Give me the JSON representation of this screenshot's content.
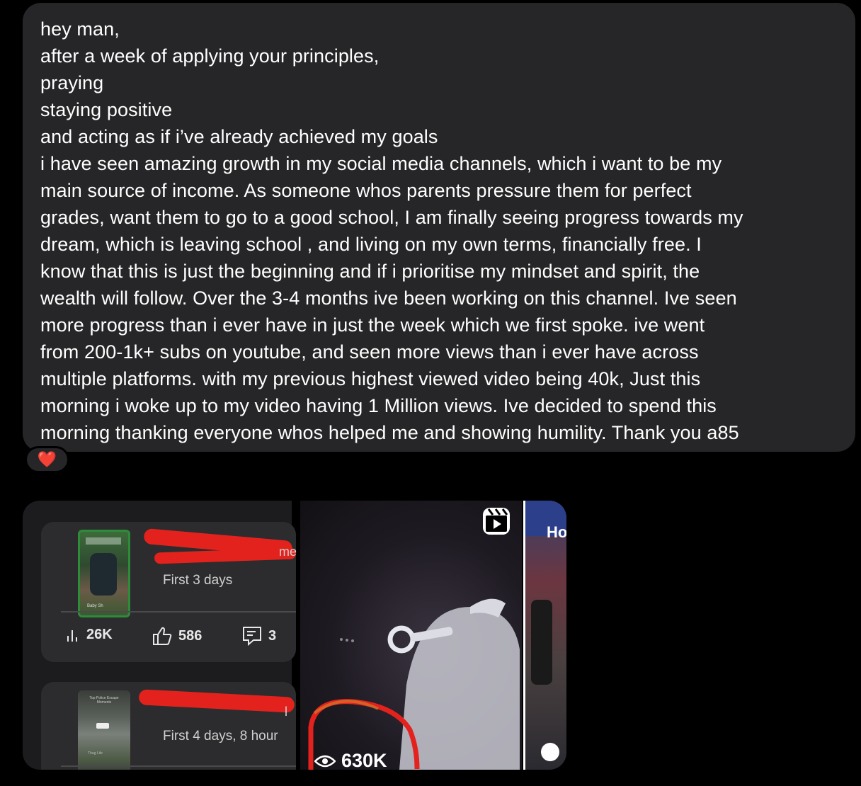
{
  "message": {
    "lines": [
      "hey man,",
      "after a week of applying your principles,",
      "praying",
      "staying positive",
      "and acting as if i’ve already achieved my goals",
      "i have seen amazing growth in my social media channels, which i  want to be my",
      "main source of income. As someone whos parents pressure them for perfect",
      "grades, want them to go to a good school, I am finally seeing progress towards my",
      "dream, which is leaving school , and living on my own terms, financially free. I",
      "know that this is just the beginning and if i prioritise my mindset and spirit, the",
      "wealth will follow. Over the 3-4 months ive been working on this channel. Ive seen",
      "more progress than i ever have in just the week which we first spoke. ive went",
      "from 200-1k+ subs on youtube, and seen more views than i ever have across",
      "multiple platforms. with my previous highest viewed video being 40k, Just this",
      "morning i woke up to my video having 1 Million views. Ive decided to spend this",
      "morning thanking everyone whos helped me and showing humility. Thank you a85"
    ],
    "reaction": "❤️"
  },
  "media": {
    "card1": {
      "title_fragment": "me",
      "subtitle": "First 3 days",
      "views": "26K",
      "likes": "586",
      "comments": "3",
      "thumb_label": "Baby Sh"
    },
    "card2": {
      "title_fragment": "l",
      "subtitle": "First 4 days, 8 hour",
      "thumb_label": "Top Police Escape Moments",
      "thumb_footer": "Thug Life"
    },
    "reel": {
      "views": "630K"
    },
    "side_text": "Ho"
  },
  "colors": {
    "bubble": "#262628",
    "redaction": "#e4221d",
    "heart": "#e0303a"
  }
}
